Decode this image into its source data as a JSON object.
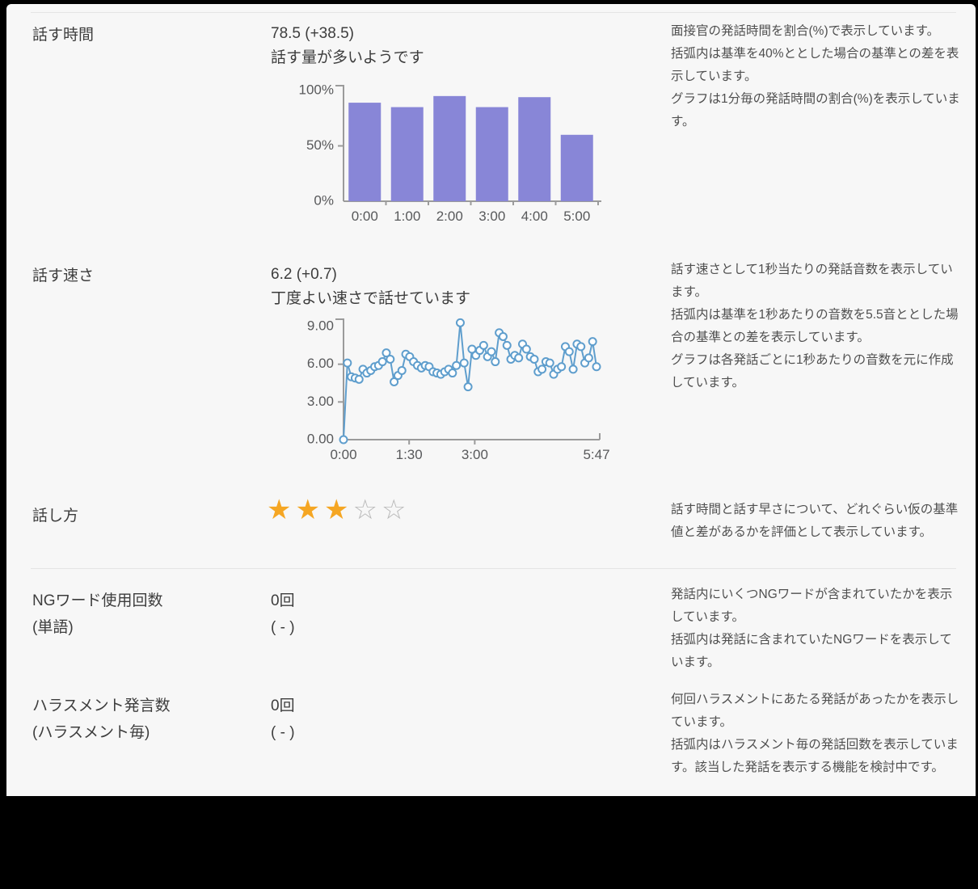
{
  "colors": {
    "panel_bg": "#f7f7f7",
    "page_bg": "#000000",
    "bar_fill": "#8886d7",
    "line_stroke": "#5f9ecd",
    "marker_fill": "#ffffff",
    "axis": "#9b9b9b",
    "tick_label": "#58595b",
    "star_filled": "#f5a623",
    "star_empty": "#b9b9b9",
    "divider": "#e4e4e4"
  },
  "sections": {
    "time": {
      "label": "話す時間",
      "value": "78.5 (+38.5)",
      "comment": "話す量が多いようです",
      "description": "面接官の発話時間を割合(%)で表示しています。\n括弧内は基準を40%ととした場合の基準との差を表示しています。\nグラフは1分毎の発話時間の割合(%)を表示しています。"
    },
    "speed": {
      "label": "話す速さ",
      "value": "6.2 (+0.7)",
      "comment": "丁度よい速さで話せています",
      "description": "話す速さとして1秒当たりの発話音数を表示しています。\n括弧内は基準を1秒あたりの音数を5.5音ととした場合の基準との差を表示しています。\nグラフは各発話ごとに1秒あたりの音数を元に作成しています。"
    },
    "style": {
      "label": "話し方",
      "stars": 3,
      "stars_max": 5,
      "description": "話す時間と話す早さについて、どれぐらい仮の基準値と差があるかを評価として表示しています。"
    },
    "ng": {
      "label": "NGワード使用回数",
      "label_sub": "(単語)",
      "value": "0回",
      "value_sub": "( - )",
      "description": "発話内にいくつNGワードが含まれていたかを表示しています。\n括弧内は発話に含まれていたNGワードを表示しています。"
    },
    "harassment": {
      "label": "ハラスメント発言数",
      "label_sub": "(ハラスメント毎)",
      "value": "0回",
      "value_sub": "( - )",
      "description": "何回ハラスメントにあたる発話があったかを表示しています。\n括弧内はハラスメント毎の発話回数を表示しています。該当した発話を表示する機能を検討中です。"
    }
  },
  "chart_data": [
    {
      "type": "bar",
      "title": "",
      "categories": [
        "0:00",
        "1:00",
        "2:00",
        "3:00",
        "4:00",
        "5:00"
      ],
      "values": [
        89,
        85,
        95,
        85,
        94,
        60
      ],
      "xlabel": "",
      "ylabel": "",
      "ylim": [
        0,
        100
      ],
      "y_ticks": [
        0,
        50,
        100
      ],
      "y_tick_labels": [
        "0%",
        "50%",
        "100%"
      ],
      "grid": false,
      "legend": false
    },
    {
      "type": "line",
      "title": "",
      "xlabel": "",
      "ylabel": "",
      "ylim": [
        0,
        9.3
      ],
      "y_ticks": [
        0,
        3,
        6,
        9
      ],
      "y_tick_labels": [
        "0.00",
        "3.00",
        "6.00",
        "9.00"
      ],
      "x_ticks_seconds": [
        0,
        90,
        180,
        347
      ],
      "x_tick_labels": [
        "0:00",
        "1:30",
        "3:00",
        "5:47"
      ],
      "x_total_seconds": 347,
      "grid": false,
      "legend": false,
      "values": [
        0.0,
        6.1,
        5.0,
        4.9,
        4.8,
        5.6,
        5.3,
        5.5,
        5.8,
        5.9,
        6.2,
        6.9,
        6.4,
        4.6,
        5.1,
        5.5,
        6.8,
        6.6,
        6.2,
        5.9,
        5.7,
        5.9,
        5.8,
        5.4,
        5.3,
        5.2,
        5.4,
        5.6,
        5.3,
        5.9,
        9.3,
        6.1,
        4.2,
        7.2,
        6.7,
        7.1,
        7.5,
        6.6,
        7.0,
        6.2,
        8.5,
        8.2,
        7.5,
        6.4,
        6.7,
        6.5,
        7.6,
        7.2,
        6.6,
        6.4,
        5.4,
        5.6,
        6.2,
        6.1,
        5.2,
        5.6,
        5.8,
        7.4,
        7.0,
        5.6,
        7.6,
        7.4,
        6.1,
        6.5,
        7.8,
        5.8
      ]
    }
  ]
}
